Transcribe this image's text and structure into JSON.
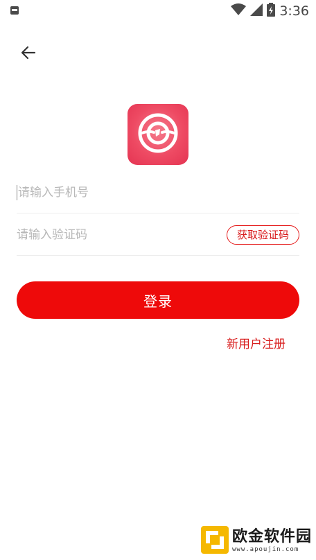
{
  "status_bar": {
    "time": "3:36"
  },
  "login": {
    "phone_placeholder": "请输入手机号",
    "code_placeholder": "请输入验证码",
    "get_code_label": "获取验证码",
    "login_label": "登录",
    "register_label": "新用户注册"
  },
  "watermark": {
    "main": "欧金软件园",
    "sub": "www.apoujin.com"
  },
  "colors": {
    "primary": "#ee0a0a",
    "logo": "#ee4a63",
    "link": "#d81b1b"
  },
  "icons": {
    "back": "arrow-left-icon",
    "logo": "app-logo-icon"
  }
}
